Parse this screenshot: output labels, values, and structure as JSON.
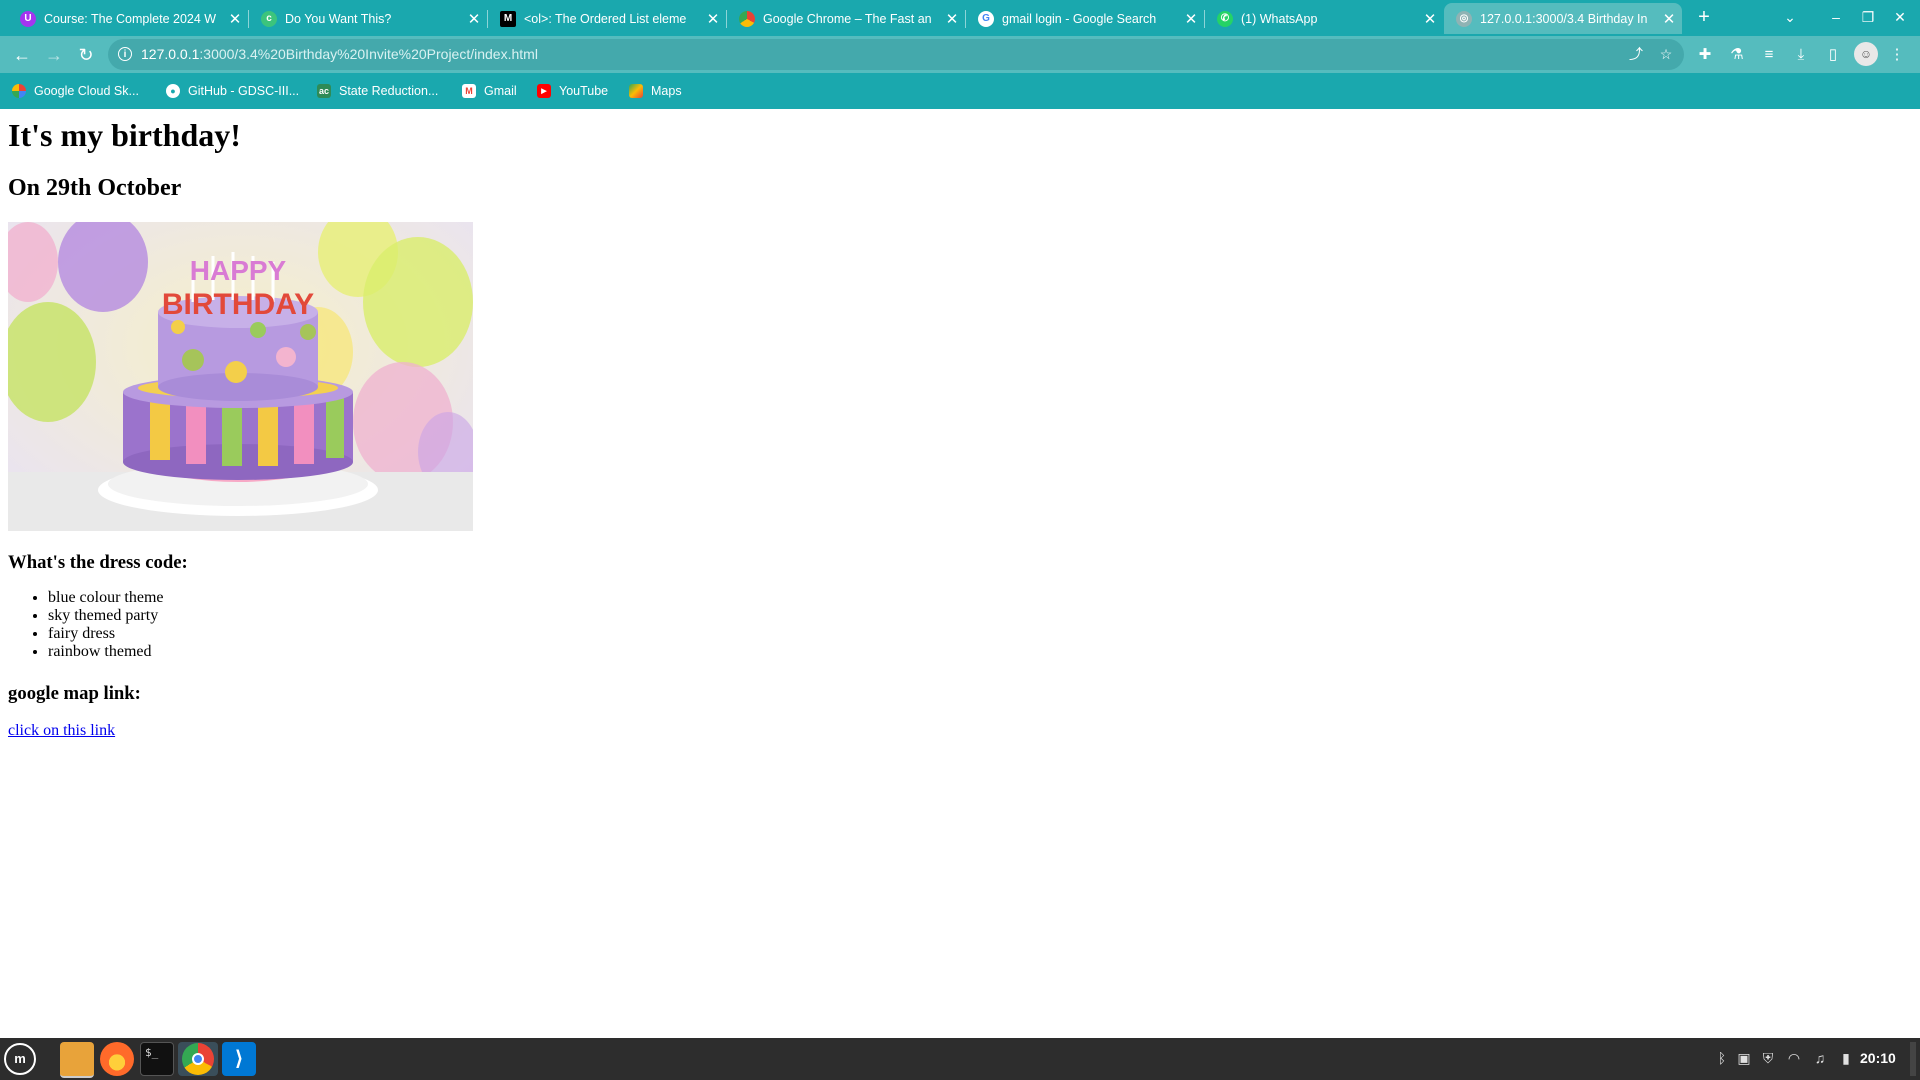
{
  "browser": {
    "tabs": [
      {
        "title": "Course: The Complete 2024 W",
        "favicon": "udemy-icon",
        "active": false
      },
      {
        "title": "Do You Want This?",
        "favicon": "green-circle-icon",
        "active": false
      },
      {
        "title": "<ol>: The Ordered List eleme",
        "favicon": "mdn-icon",
        "active": false
      },
      {
        "title": "Google Chrome – The Fast an",
        "favicon": "chrome-icon",
        "active": false
      },
      {
        "title": "gmail login - Google Search",
        "favicon": "google-icon",
        "active": false
      },
      {
        "title": "(1) WhatsApp",
        "favicon": "whatsapp-icon",
        "active": false
      },
      {
        "title": "127.0.0.1:3000/3.4 Birthday In",
        "favicon": "globe-icon",
        "active": true
      }
    ],
    "new_tab_label": "+",
    "url_host": "127.0.0.1",
    "url_rest": ":3000/3.4%20Birthday%20Invite%20Project/index.html",
    "bookmarks": [
      {
        "label": "Google Cloud Sk...",
        "icon": "google-cloud-icon"
      },
      {
        "label": "GitHub - GDSC-III...",
        "icon": "github-icon"
      },
      {
        "label": "State Reduction...",
        "icon": "state-reduction-icon"
      },
      {
        "label": "Gmail",
        "icon": "gmail-icon"
      },
      {
        "label": "YouTube",
        "icon": "youtube-icon"
      },
      {
        "label": "Maps",
        "icon": "maps-icon"
      }
    ]
  },
  "page": {
    "heading": "It's my birthday!",
    "date_heading": "On 29th October",
    "image": {
      "banner_text_1": "HAPPY",
      "banner_text_2": "BIRTHDAY"
    },
    "dress_code_heading": "What's the dress code:",
    "dress_code_items": [
      "blue colour theme",
      "sky themed party",
      "fairy dress",
      "rainbow themed"
    ],
    "map_heading": "google map link:",
    "map_link_text": "click on this link"
  },
  "taskbar": {
    "clock": "20:10",
    "apps": [
      "mint-menu-icon",
      "files-icon",
      "firefox-icon",
      "terminal-icon",
      "chrome-icon",
      "vscode-icon"
    ]
  },
  "colors": {
    "chrome_bg": "#1aa8ae",
    "toolbar_bg": "#55bcbe",
    "link": "#0000ee",
    "taskbar_bg": "#2d2d2d"
  }
}
